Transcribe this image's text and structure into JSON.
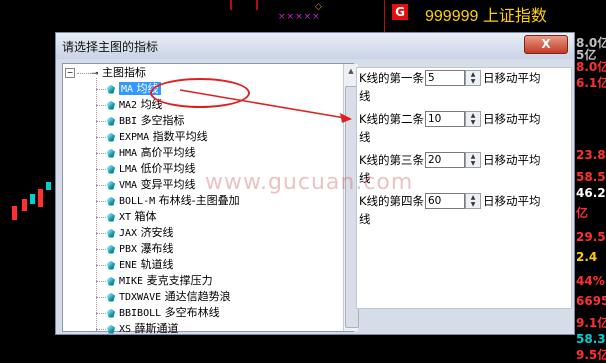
{
  "app": {
    "stars": "×××××",
    "badge": "G",
    "stock_code_name": "999999 上证指数",
    "right_panel_values": [
      "8.0亿",
      "5亿",
      "8.0亿",
      "6.1亿",
      "23.80",
      "58.5",
      "46.2",
      "亿",
      "29.5",
      "2.4",
      "44%",
      "6695",
      "9.1亿",
      "58.3亿",
      "9.5亿"
    ]
  },
  "dialog": {
    "title": "请选择主图的指标",
    "close_label": "X",
    "tree": {
      "root_label": "主图指标",
      "items": [
        {
          "code": "MA",
          "name": "均线",
          "selected": true
        },
        {
          "code": "MA2",
          "name": "均线"
        },
        {
          "code": "BBI",
          "name": "多空指标"
        },
        {
          "code": "EXPMA",
          "name": "指数平均线"
        },
        {
          "code": "HMA",
          "name": "高价平均线"
        },
        {
          "code": "LMA",
          "name": "低价平均线"
        },
        {
          "code": "VMA",
          "name": "变异平均线"
        },
        {
          "code": "BOLL-M",
          "name": "布林线-主图叠加"
        },
        {
          "code": "XT",
          "name": "箱体"
        },
        {
          "code": "JAX",
          "name": "济安线"
        },
        {
          "code": "PBX",
          "name": "瀑布线"
        },
        {
          "code": "ENE",
          "name": "轨道线"
        },
        {
          "code": "MIKE",
          "name": "麦克支撑压力"
        },
        {
          "code": "TDXWAVE",
          "name": "通达信趋势浪"
        },
        {
          "code": "BBIBOLL",
          "name": "多空布林线"
        },
        {
          "code": "XS",
          "name": "薛斯通道"
        }
      ]
    },
    "params": [
      {
        "prefix": "K线的第一条",
        "value": "5",
        "suffix": "日移动平均",
        "wrap": "线"
      },
      {
        "prefix": "K线的第二条",
        "value": "10",
        "suffix": "日移动平均",
        "wrap": "线"
      },
      {
        "prefix": "K线的第三条",
        "value": "20",
        "suffix": "日移动平均",
        "wrap": "线"
      },
      {
        "prefix": "K线的第四条",
        "value": "60",
        "suffix": "日移动平均",
        "wrap": "线"
      }
    ]
  },
  "watermark": "www.gucuan.com",
  "colors": {
    "accent_red": "#e02020",
    "selection_blue": "#3399ff",
    "stock_yellow": "#ffd000"
  }
}
